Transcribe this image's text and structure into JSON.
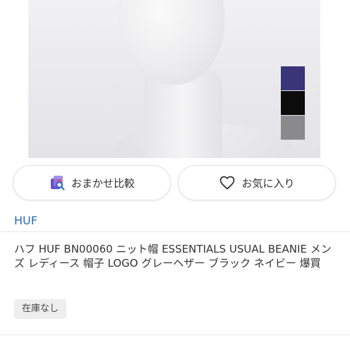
{
  "product": {
    "brand": "HUF",
    "title": "ハフ HUF BN00060 ニット帽 ESSENTIALS USUAL BEANIE メンズ レディース 帽子 LOGO グレーヘザー ブラック ネイビー 爆買",
    "stock_status": "在庫なし",
    "color_swatches": [
      {
        "name": "navy",
        "color": "#3a3479"
      },
      {
        "name": "black",
        "color": "#0c0c0c"
      },
      {
        "name": "gray",
        "color": "#8a8a8c"
      }
    ]
  },
  "actions": {
    "compare_label": "おまかせ比較",
    "compare_icon": "compare-icon",
    "favorite_label": "お気に入り",
    "favorite_icon": "heart-outline-icon"
  }
}
